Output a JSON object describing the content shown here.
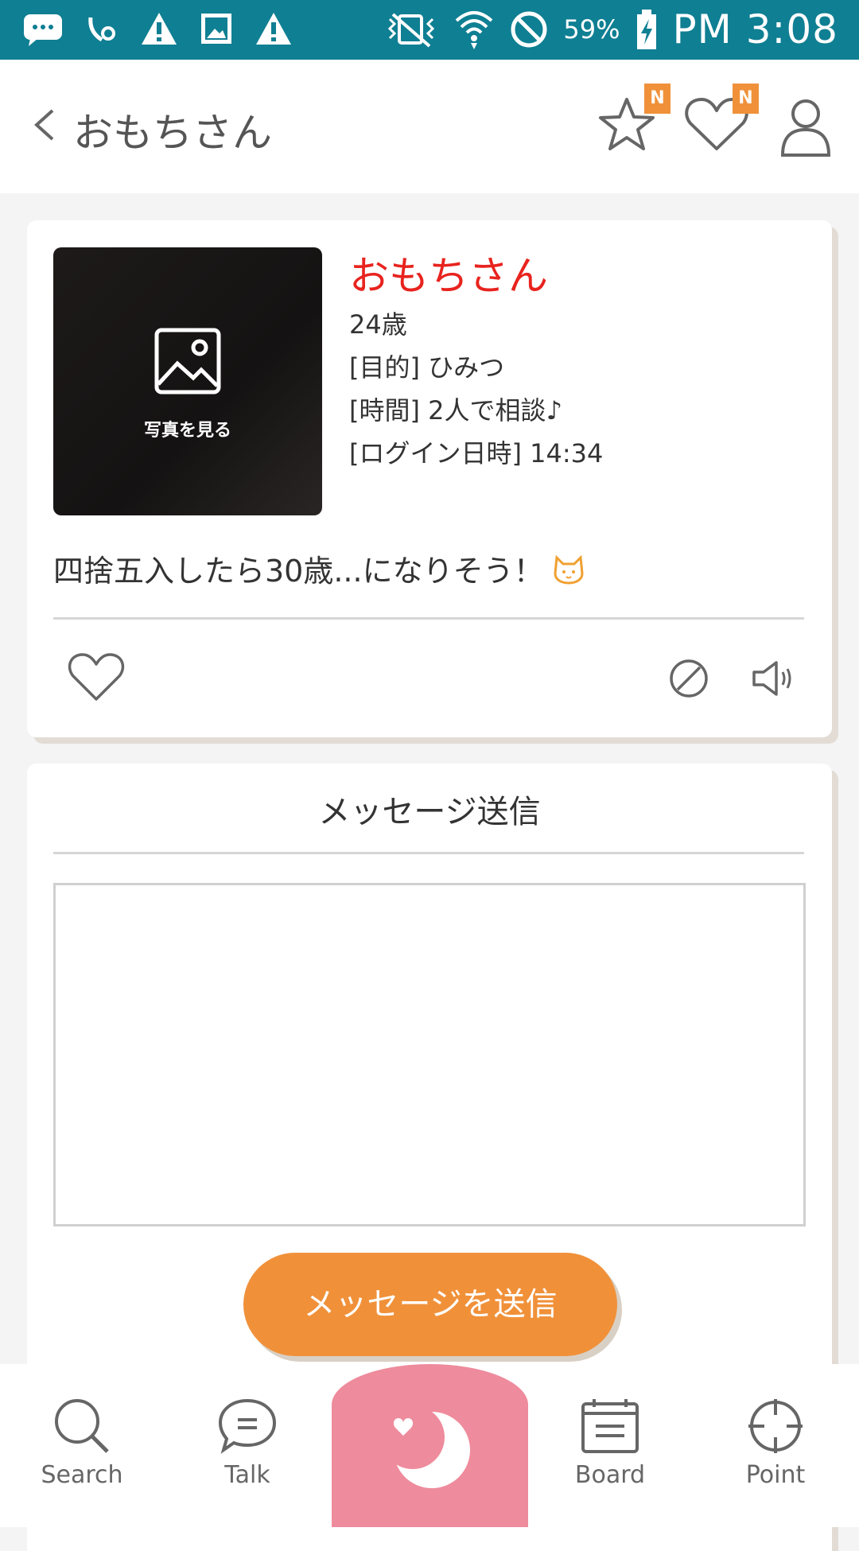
{
  "status_bar": {
    "battery_percent": "59%",
    "time": "PM 3:08",
    "icons": [
      "message-icon",
      "call-settings-icon",
      "warning-icon",
      "image-icon",
      "warning-icon",
      "vibrate-mute-icon",
      "wifi-icon",
      "block-icon",
      "battery-charging-icon"
    ]
  },
  "header": {
    "title": "おもちさん",
    "badges": {
      "star": "N",
      "heart": "N"
    }
  },
  "profile": {
    "photo_label": "写真を見る",
    "name": "おもちさん",
    "age": "24歳",
    "purpose": "[目的] ひみつ",
    "time": "[時間] 2人で相談♪",
    "login": "[ログイン日時] 14:34",
    "bio": "四捨五入したら30歳...になりそう！"
  },
  "message": {
    "title": "メッセージ送信",
    "textarea_value": "",
    "send_label": "メッセージを送信"
  },
  "bottom_nav": {
    "items": [
      {
        "label": "Search"
      },
      {
        "label": "Talk"
      },
      {
        "label": "Board"
      },
      {
        "label": "Point"
      }
    ]
  },
  "colors": {
    "status_bar": "#0f7f93",
    "accent_orange": "#f0913a",
    "name_red": "#e8231e",
    "center_pink": "#ee8b9c"
  }
}
